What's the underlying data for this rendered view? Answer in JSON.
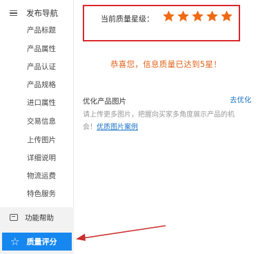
{
  "sidebar": {
    "header_label": "发布导航",
    "items": [
      {
        "label": "产品标题"
      },
      {
        "label": "产品属性"
      },
      {
        "label": "产品认证"
      },
      {
        "label": "产品规格"
      },
      {
        "label": "进口属性"
      },
      {
        "label": "交易信息"
      },
      {
        "label": "上传图片"
      },
      {
        "label": "详细说明"
      },
      {
        "label": "物流运费"
      },
      {
        "label": "特色服务"
      }
    ],
    "help_label": "功能帮助",
    "quality_label": "质量评分"
  },
  "rating": {
    "label": "当前质量星级：",
    "stars": 5,
    "max_stars": 5,
    "star_color": "#ef6a13"
  },
  "congrats": "恭喜您，信息质量已达到5星！",
  "optimize": {
    "title": "优化产品图片",
    "link": "去优化",
    "desc": "请上传更多图片，把握向买家多角度展示产品的机会！",
    "desc_link": "优质图片案例"
  },
  "colors": {
    "accent_blue": "#1787f0",
    "highlight_red": "#d9272a",
    "congrats_orange": "#e0641a"
  }
}
